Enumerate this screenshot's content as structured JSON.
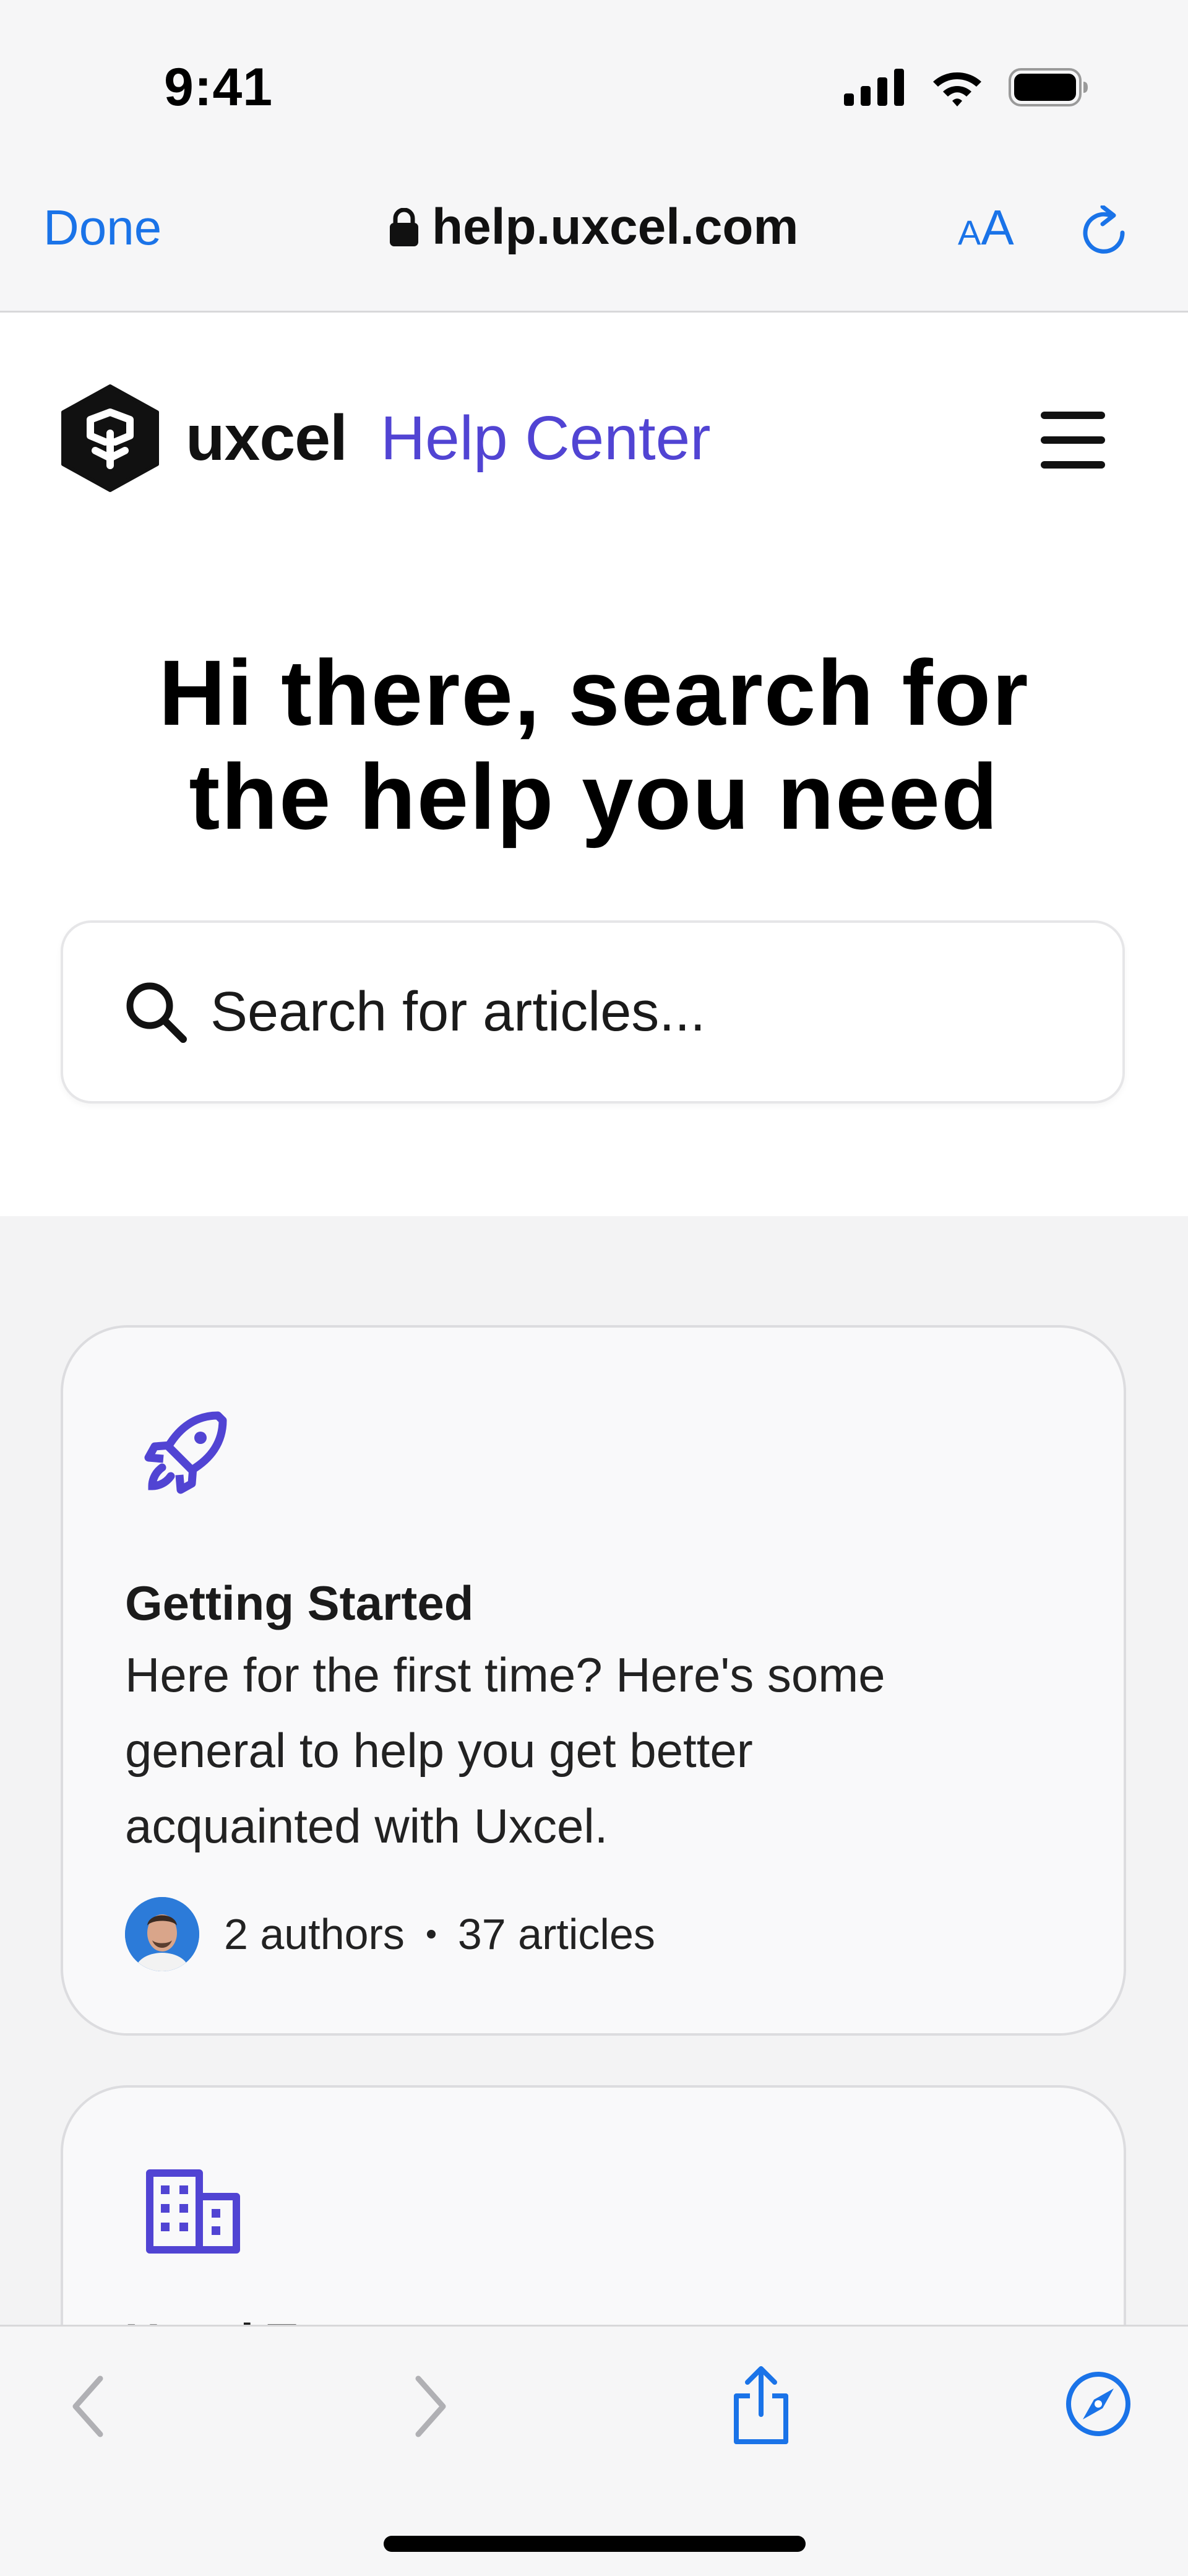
{
  "status_bar": {
    "time": "9:41",
    "icons": [
      "cellular-signal-icon",
      "wifi-icon",
      "battery-icon"
    ]
  },
  "browser": {
    "done_label": "Done",
    "url": "help.uxcel.com",
    "text_size_label_small": "A",
    "text_size_label_large": "A",
    "accent_color": "#1a73e8"
  },
  "site_header": {
    "brand": "uxcel",
    "section": "Help Center",
    "section_color": "#5144d3"
  },
  "hero": {
    "title_line1": "Hi there, search for",
    "title_line2": "the help you need"
  },
  "search": {
    "placeholder": "Search for articles..."
  },
  "collections": [
    {
      "icon": "rocket-icon",
      "title": "Getting Started",
      "description_line1": "Here for the first time? Here's some",
      "description_line2": "general to help you get better",
      "description_line3": "acquainted with Uxcel.",
      "authors": "2 authors",
      "articles": "37 articles"
    },
    {
      "icon": "building-icon",
      "title": "Uxcel Teams"
    }
  ],
  "toolbar": {
    "icons": [
      "back-icon",
      "forward-icon",
      "share-icon",
      "compass-icon"
    ]
  }
}
